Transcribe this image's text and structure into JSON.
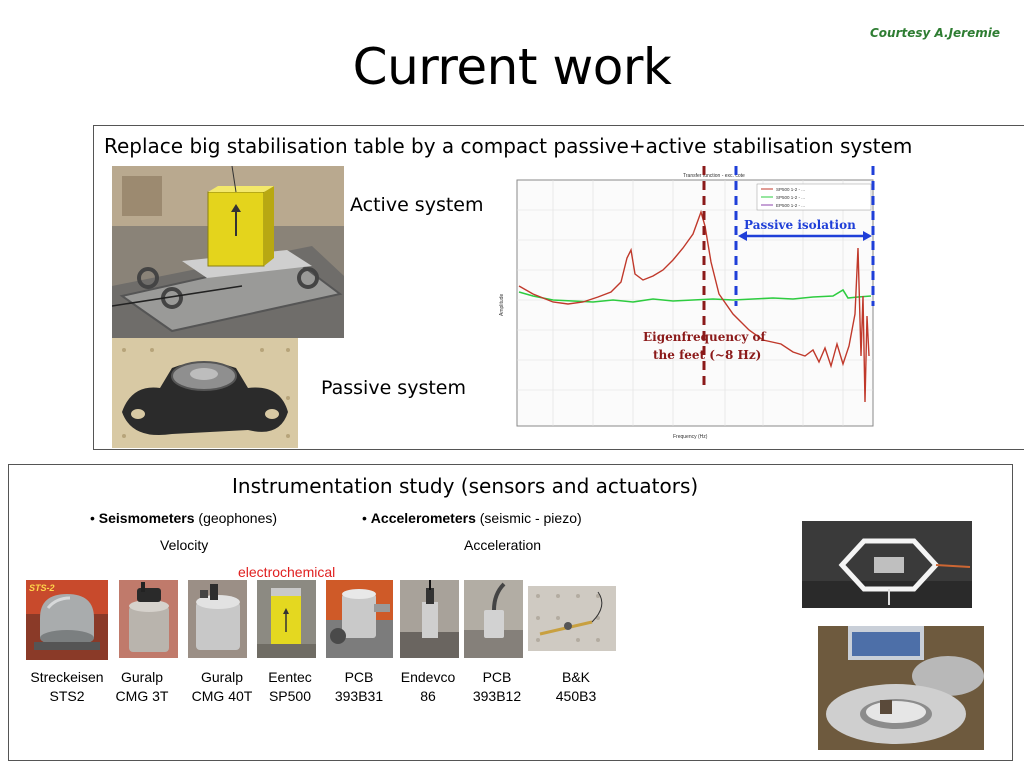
{
  "slide": {
    "courtesy": "Courtesy A.Jeremie",
    "title": "Current work"
  },
  "stabilisation": {
    "heading": "Replace big stabilisation table by a compact passive+active stabilisation system",
    "active_label": "Active system",
    "passive_label": "Passive system",
    "plot": {
      "header_text": "Transfer function - exc. cote",
      "legend": [
        "SP500 1-2 - ...",
        "SP500 1-2 - ...",
        "EP500 1-2 - ..."
      ],
      "passive_isolation": "Passive isolation",
      "eigen_line1": "Eigenfrequency of",
      "eigen_line2": "the feet (~8 Hz)",
      "ylabel": "Amplitude",
      "xlabel": "Frequency (Hz)",
      "colors": {
        "red": "#c0392b",
        "green": "#2ecc40",
        "blue": "#1f3fd8",
        "darkred": "#8b1a1a"
      }
    }
  },
  "instrumentation": {
    "heading": "Instrumentation study (sensors and actuators)",
    "seismometers_bold": "Seismometers",
    "seismometers_rest": " (geophones)",
    "accelerometers_bold": "Accelerometers",
    "accelerometers_rest": " (seismic - piezo)",
    "velocity": "Velocity",
    "acceleration": "Acceleration",
    "electrochemical": "electrochemical",
    "sts_tag": "STS-2",
    "sensors": [
      {
        "line1": "Streckeisen",
        "line2": "STS2"
      },
      {
        "line1": "Guralp",
        "line2": "CMG 3T"
      },
      {
        "line1": "Guralp",
        "line2": "CMG 40T"
      },
      {
        "line1": "Eentec",
        "line2": "SP500"
      },
      {
        "line1": "PCB",
        "line2": "393B31"
      },
      {
        "line1": "Endevco",
        "line2": "86"
      },
      {
        "line1": "PCB",
        "line2": "393B12"
      },
      {
        "line1": "B&K",
        "line2": "450B3"
      }
    ]
  }
}
